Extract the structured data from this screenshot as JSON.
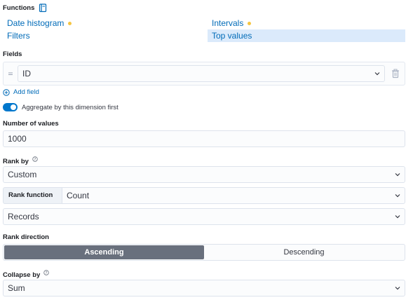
{
  "functions": {
    "label": "Functions",
    "items": [
      {
        "label": "Date histogram",
        "dot": true
      },
      {
        "label": "Intervals",
        "dot": true
      },
      {
        "label": "Filters",
        "dot": false
      },
      {
        "label": "Top values",
        "dot": false,
        "selected": true
      }
    ]
  },
  "fields": {
    "label": "Fields",
    "field_value": "ID",
    "add_field": "Add field"
  },
  "aggregate_toggle": {
    "label": "Aggregate by this dimension first",
    "on": true
  },
  "number_of_values": {
    "label": "Number of values",
    "value": "1000"
  },
  "rank_by": {
    "label": "Rank by",
    "value": "Custom",
    "rank_function_label": "Rank function",
    "rank_function_value": "Count",
    "records_value": "Records"
  },
  "rank_direction": {
    "label": "Rank direction",
    "options": [
      "Ascending",
      "Descending"
    ],
    "selected": "Ascending"
  },
  "collapse_by": {
    "label": "Collapse by",
    "value": "Sum"
  },
  "colors": {
    "link": "#006bb8",
    "dot": "#f5c542",
    "toggle_on": "#0077cc",
    "segment_active": "#69707d",
    "selected_bg": "#dbeafb"
  }
}
